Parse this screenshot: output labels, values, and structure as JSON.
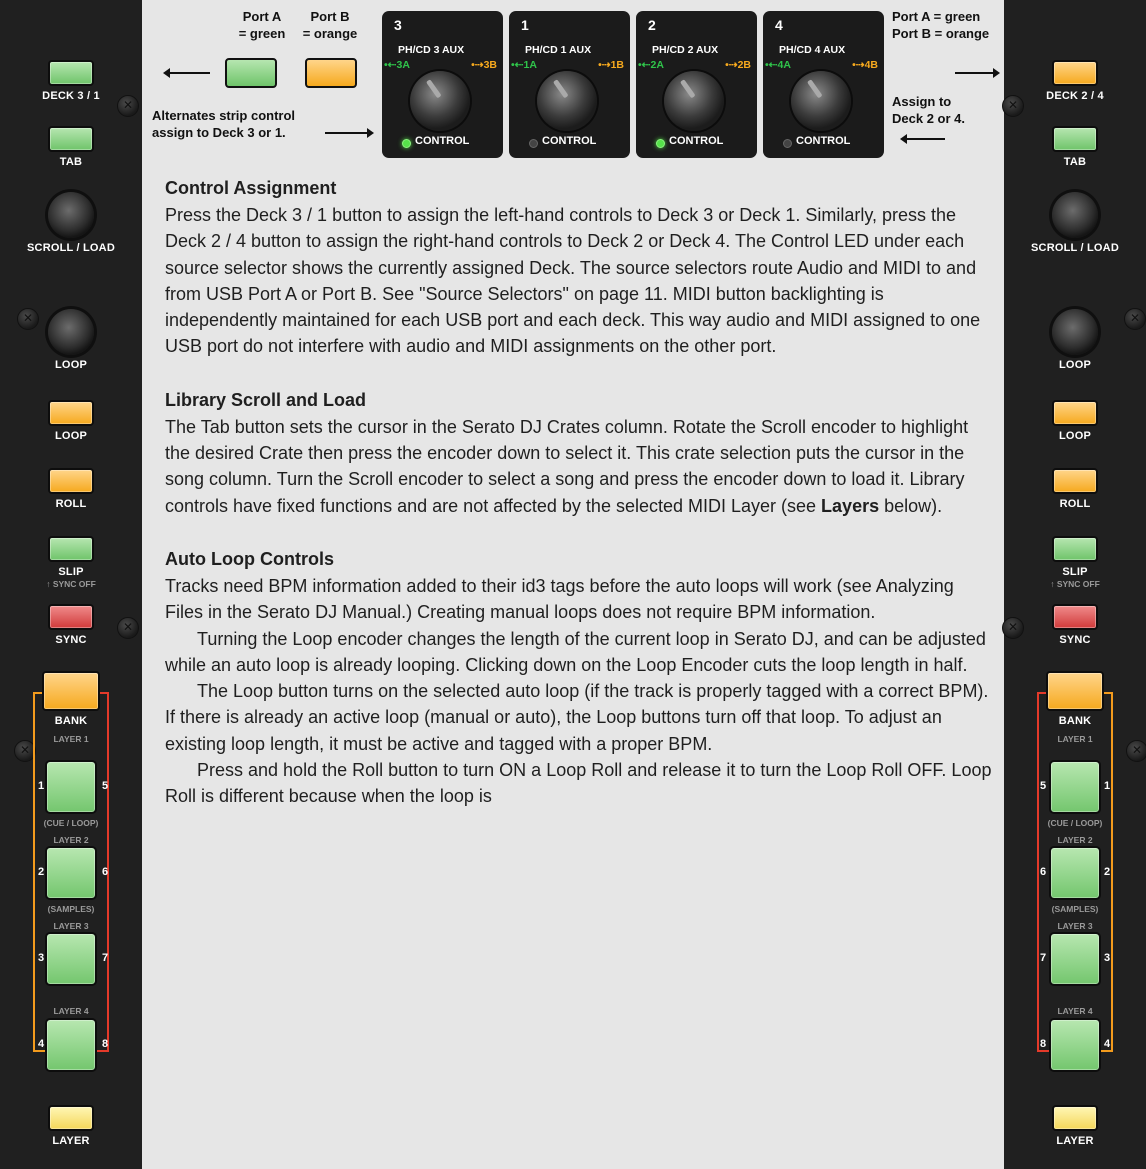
{
  "left_strip": {
    "deck_label": "DECK 3 / 1",
    "tab_label": "TAB",
    "scroll_label": "SCROLL / LOAD",
    "loop_knob_label": "LOOP",
    "loop_btn_label": "LOOP",
    "roll_label": "ROLL",
    "slip_label": "SLIP",
    "sync_off_label": "↑ SYNC OFF",
    "sync_label": "SYNC",
    "bank_label": "BANK",
    "layer1": "LAYER 1",
    "cue_loop": "(CUE / LOOP)",
    "layer2": "LAYER 2",
    "samples": "(SAMPLES)",
    "layer3": "LAYER 3",
    "layer4": "LAYER 4",
    "layer_label": "LAYER",
    "pad_nums": [
      "1",
      "5",
      "2",
      "6",
      "3",
      "7",
      "4",
      "8"
    ]
  },
  "right_strip": {
    "deck_label": "DECK 2 / 4",
    "tab_label": "TAB",
    "scroll_label": "SCROLL / LOAD",
    "loop_knob_label": "LOOP",
    "loop_btn_label": "LOOP",
    "roll_label": "ROLL",
    "slip_label": "SLIP",
    "sync_off_label": "↑ SYNC OFF",
    "sync_label": "SYNC",
    "bank_label": "BANK",
    "layer1": "LAYER 1",
    "cue_loop": "(CUE / LOOP)",
    "layer2": "LAYER 2",
    "samples": "(SAMPLES)",
    "layer3": "LAYER 3",
    "layer4": "LAYER 4",
    "layer_label": "LAYER",
    "pad_nums": [
      "5",
      "1",
      "6",
      "2",
      "7",
      "3",
      "8",
      "4"
    ]
  },
  "legend": {
    "port_a_1": "Port A",
    "port_a_2": "= green",
    "port_b_1": "Port B",
    "port_b_2": "= orange",
    "alt_1": "Alternates strip control",
    "alt_2": "assign to Deck 3 or 1.",
    "right_a": "Port A = green",
    "right_b": "Port B = orange",
    "assign_1": "Assign to",
    "assign_2": "Deck 2 or 4."
  },
  "selectors": [
    {
      "num": "3",
      "src": "PH/CD 3   AUX",
      "pa": "•⇠3A",
      "pb": "•⇢3B",
      "control": "CONTROL",
      "led_on": true
    },
    {
      "num": "1",
      "src": "PH/CD 1   AUX",
      "pa": "•⇠1A",
      "pb": "•⇢1B",
      "control": "CONTROL",
      "led_on": false
    },
    {
      "num": "2",
      "src": "PH/CD 2   AUX",
      "pa": "•⇠2A",
      "pb": "•⇢2B",
      "control": "CONTROL",
      "led_on": true
    },
    {
      "num": "4",
      "src": "PH/CD 4   AUX",
      "pa": "•⇠4A",
      "pb": "•⇢4B",
      "control": "CONTROL",
      "led_on": false
    }
  ],
  "sections": {
    "control_assignment": {
      "heading": "Control Assignment",
      "text": "Press the Deck 3 / 1 button to assign the left-hand controls to Deck 3 or Deck 1. Similarly, press the Deck 2 / 4 button to assign the right-hand controls to Deck 2 or Deck 4. The Control LED under each source selector shows the currently assigned Deck. The source selectors route Audio and MIDI to and from USB Port A or Port B. See \"Source Selectors\" on page 11. MIDI button backlighting is independently maintained for each USB port and each deck. This way audio and MIDI assigned to one USB port do not interfere with audio and MIDI assignments on the other port."
    },
    "library": {
      "heading": "Library Scroll and Load",
      "text_1": "The Tab button sets the cursor in the Serato DJ Crates column. Rotate the Scroll encoder to highlight the desired Crate then press the encoder down to select it. This crate selection puts the cursor in the song column. Turn the Scroll encoder to select a song and press the encoder down to load it. Library controls have fixed functions and are not affected by the selected MIDI Layer (see ",
      "text_bold": "Layers",
      "text_2": " below)."
    },
    "auto_loop": {
      "heading": "Auto Loop Controls",
      "p1": "Tracks need BPM information added to their id3 tags before the auto loops will work (see Analyzing Files in the Serato DJ Manual.) Creating manual loops does not require BPM information.",
      "p2": "Turning the Loop encoder changes the length of the current loop in Serato DJ, and can be adjusted while an auto loop is already looping. Clicking down on the Loop Encoder cuts the loop length in half.",
      "p3": "The Loop button turns on the selected auto loop (if the track is properly tagged with a correct BPM). If there is already an active loop (manual or auto), the Loop buttons turn off that loop. To adjust an existing loop length, it must be active and tagged with a proper BPM.",
      "p4": "Press and hold the Roll button to turn ON a Loop Roll and release it to turn the Loop Roll OFF. Loop Roll is different because when the loop is"
    }
  }
}
